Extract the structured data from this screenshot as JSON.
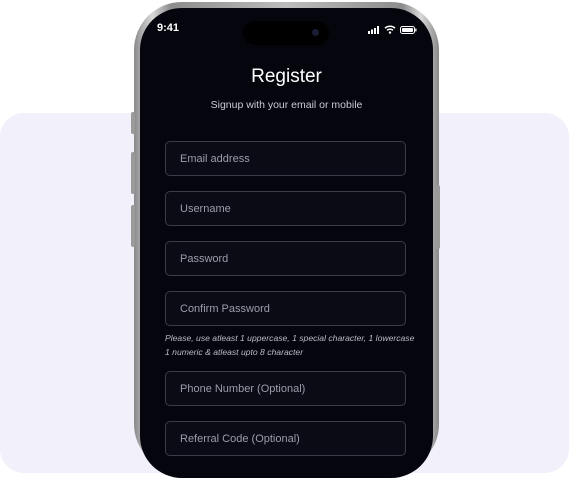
{
  "status_bar": {
    "time": "9:41"
  },
  "register": {
    "title": "Register",
    "subtitle": "Signup with your email or mobile",
    "fields": [
      {
        "placeholder": "Email address"
      },
      {
        "placeholder": "Username"
      },
      {
        "placeholder": "Password"
      },
      {
        "placeholder": "Confirm Password"
      },
      {
        "placeholder": "Phone Number (Optional)"
      },
      {
        "placeholder": "Referral Code (Optional)"
      }
    ],
    "password_hint": "Please, use atleast 1 uppercase, 1 special character, 1 lowercase 1 numeric & atleast upto 8 character"
  },
  "icons": [
    "signal-icon",
    "wifi-icon",
    "battery-icon"
  ],
  "colors": {
    "background_panel": "#f1f0fb",
    "screen_background": "#04050d",
    "field_border": "#3a3c48"
  }
}
